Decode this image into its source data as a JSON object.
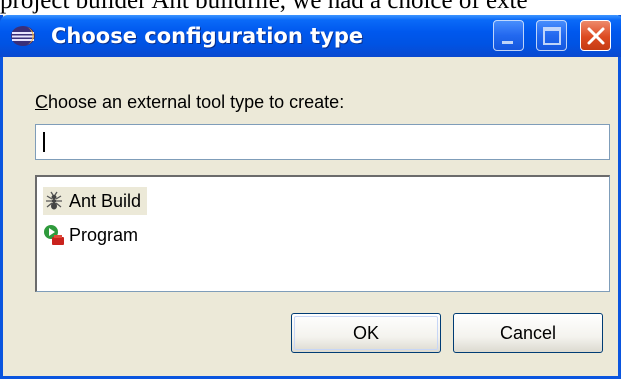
{
  "background_text": "project builder Ant buildfile, we had a choice of exte",
  "window": {
    "title": "Choose configuration type",
    "app_icon": "eclipse-icon",
    "controls": {
      "minimize": "minimize-icon",
      "maximize": "maximize-icon",
      "close": "close-icon"
    }
  },
  "prompt": {
    "mnemonic": "C",
    "rest": "hoose an external tool type to create:"
  },
  "search": {
    "value": "",
    "placeholder": ""
  },
  "list": {
    "items": [
      {
        "label": "Ant Build",
        "icon": "ant-icon",
        "selected": true
      },
      {
        "label": "Program",
        "icon": "program-icon",
        "selected": false
      }
    ]
  },
  "buttons": {
    "ok": "OK",
    "cancel": "Cancel"
  },
  "colors": {
    "titlebar": "#0058ee",
    "dialog_bg": "#ece9d8",
    "close": "#dd4a21",
    "border": "#0a55df"
  }
}
